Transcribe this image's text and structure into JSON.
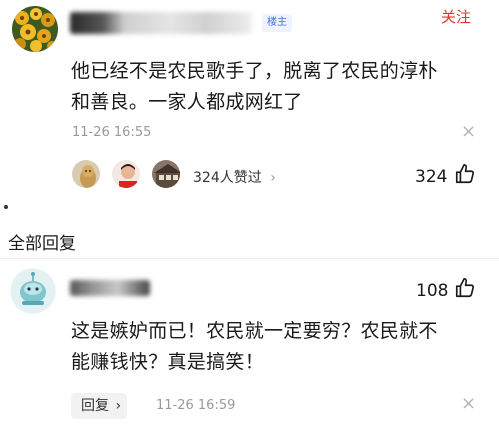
{
  "top_comment": {
    "owner_badge": "楼主",
    "follow": "关注",
    "text_line1": "他已经不是农民歌手了，脱离了农民的淳朴",
    "text_line2": "和善良。一家人都成网红了",
    "time": "11-26 16:55",
    "likes_text": "324人赞过",
    "likes_chevron": "›",
    "like_count": "324",
    "close": "×"
  },
  "section": {
    "title": "全部回复"
  },
  "reply": {
    "like_count": "108",
    "text_line1": "这是嫉妒而已！农民就一定要穷？农民就不",
    "text_line2": "能赚钱快？真是搞笑！",
    "reply_label": "回复",
    "reply_chevron": "›",
    "time": "11-26 16:59",
    "close": "×"
  },
  "colors": {
    "follow": "#e8342a",
    "badge_text": "#4a6fd6",
    "meta": "#999999"
  },
  "icons": [
    "thumbs-up-icon",
    "close-icon",
    "chevron-right-icon"
  ]
}
